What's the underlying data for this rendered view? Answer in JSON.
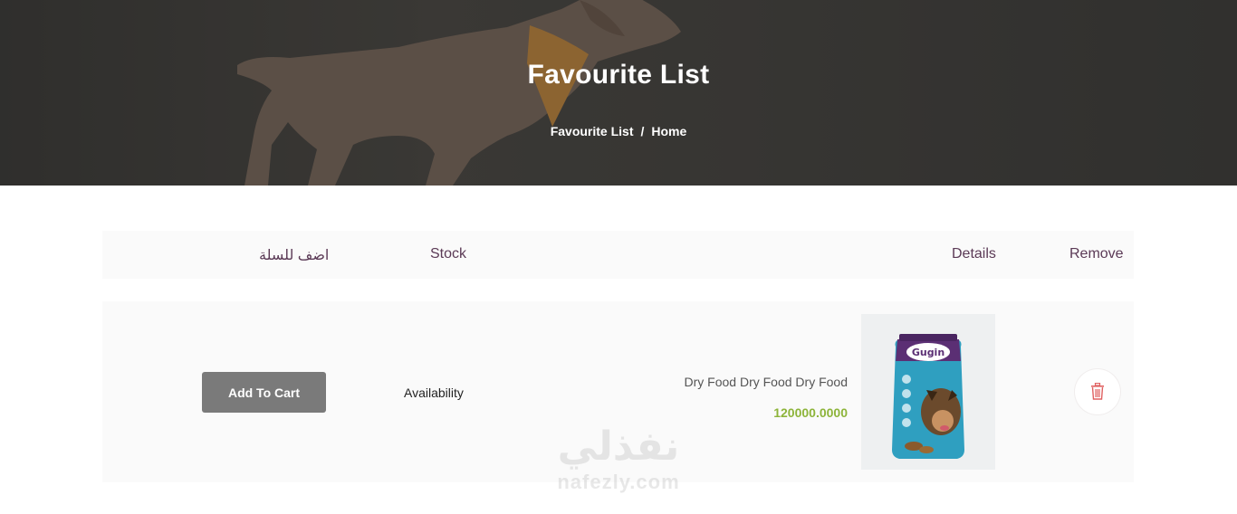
{
  "hero": {
    "title": "Favourite List",
    "breadcrumb": {
      "current": "Favourite List",
      "separator": "/",
      "home": "Home"
    }
  },
  "table": {
    "headers": {
      "add_to_cart": "اضف للسلة",
      "stock": "Stock",
      "details": "Details",
      "remove": "Remove"
    },
    "rows": [
      {
        "add_to_cart_label": "Add To Cart",
        "stock": "Availability",
        "name": "Dry Food Dry Food Dry Food",
        "price": "120000.0000",
        "package_brand": "Gugin",
        "remove_icon": "trash-icon"
      }
    ]
  },
  "watermark": {
    "arabic": "نفذلي",
    "latin": "nafezly.com"
  },
  "colors": {
    "header_text": "#5b3a56",
    "price": "#8db43a",
    "button": "#7a7a7a",
    "trash": "#e06060"
  }
}
